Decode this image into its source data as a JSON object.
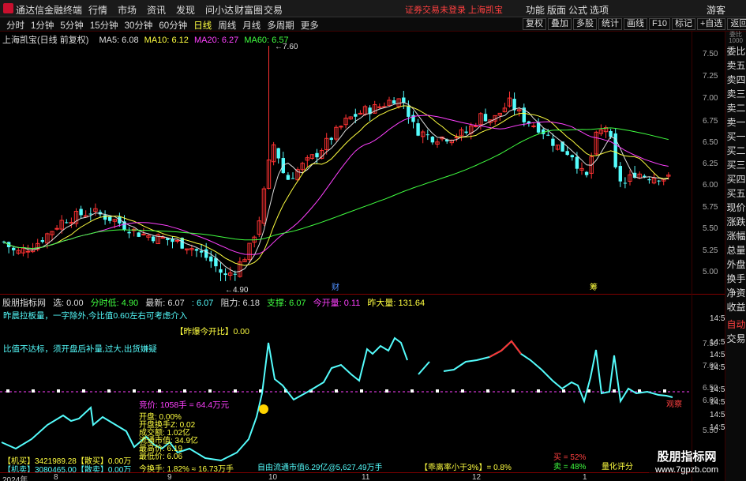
{
  "app": {
    "brand": "通达信金融终端",
    "notice": "证券交易未登录 上海凯宝",
    "guest": "游客"
  },
  "menu": [
    "行情",
    "市场",
    "资讯",
    "发现",
    "问小达",
    "财富圈",
    "交易"
  ],
  "right_menu": [
    "功能",
    "版面",
    "公式",
    "选项"
  ],
  "periods": [
    "分时",
    "1分钟",
    "5分钟",
    "15分钟",
    "30分钟",
    "60分钟",
    "日线",
    "周线",
    "月线",
    "多周期",
    "更多"
  ],
  "active_period": "日线",
  "toolbar": [
    "复权",
    "叠加",
    "多股",
    "统计",
    "画线",
    "F10",
    "标记",
    "+自选",
    "返回"
  ],
  "quote_col": {
    "header": "委比 1000",
    "items": [
      "委比",
      "卖五",
      "卖四",
      "卖三",
      "卖二",
      "卖一",
      "买一",
      "买二",
      "买三",
      "买四",
      "买五",
      "现价",
      "涨跌",
      "涨幅",
      "总量",
      "外盘",
      "换手",
      "净资",
      "收益"
    ],
    "auto": "自动",
    "trade": "交易"
  },
  "ma_line": {
    "title": "上海凯宝(日线 前复权)",
    "ma5": "MA5: 6.08",
    "ma10": "MA10: 6.12",
    "ma20": "MA20: 6.27",
    "ma60": "MA60: 6.57"
  },
  "colors": {
    "up": "#ff3232",
    "down": "#54fcfc",
    "ma5": "#dddddd",
    "ma10": "#ffff40",
    "ma20": "#ff40ff",
    "ma60": "#40ff40",
    "grid": "#800000"
  },
  "price_labels": {
    "high": "7.60",
    "low": "4.90",
    "cai": "财",
    "chou": "筹"
  },
  "price_scale": [
    "7.50",
    "7.25",
    "7.00",
    "6.75",
    "6.50",
    "6.25",
    "6.00",
    "5.75",
    "5.50",
    "5.25",
    "5.00"
  ],
  "ind_line": {
    "name": "股朋指标网",
    "xuan": "选: 0.00",
    "fenshi": "分时低: 4.90",
    "zuixin": "最新: 6.07",
    "v1": ": 6.07",
    "zuli": "阻力: 6.18",
    "zhicheng": "支撑: 6.07",
    "jinkai": "今开量: 0.11",
    "zuoda": "昨大量: 131.64"
  },
  "notes": {
    "n1": "昨晨拉板量，一字除外,今比值0.60左右可考虑介入",
    "n2": "【昨爆今开比】0.00",
    "n3": "比值不达标，须开盘后补量,过大,出货嫌疑",
    "n4": "竞价: 1058手 = 64.4万元",
    "kp": "开盘: 0.00%",
    "kphs": "开盘换手Z: 0.02",
    "cje": "成交额: 1.02亿",
    "ltsz": "流通市值: 34.9亿",
    "jl1": "最高价: 6.19",
    "jl2": "最低价: 6.06",
    "hs": "今换手: 1.82% ≈ 16.73万手",
    "jiqi": "【机买】3421989.28【散买】0.00万",
    "jiqi2": "【机卖】3080465.00【散卖】0.00万",
    "ziyou": "自由流通市值6.29亿@5,627.49万手",
    "guai": "【乖离率小于3%】= 0.8%",
    "mai1": "买 = 52%",
    "mai2": "卖 = 48%",
    "liang": "量化评分",
    "tuijian": "观察"
  },
  "sub_scale": [
    "7.50",
    "7.00",
    "6.50",
    "6.00",
    "5.50"
  ],
  "sub_times": [
    "14:50",
    "14:50",
    "14:50",
    "14:50",
    "14:50",
    "14:50",
    "14:50",
    "14:50"
  ],
  "dates": [
    "2024年",
    "8",
    "9",
    "10",
    "11",
    "12",
    "1"
  ],
  "watermark": {
    "cn": "股朋指标网",
    "url": "www.7gpzb.com"
  }
}
